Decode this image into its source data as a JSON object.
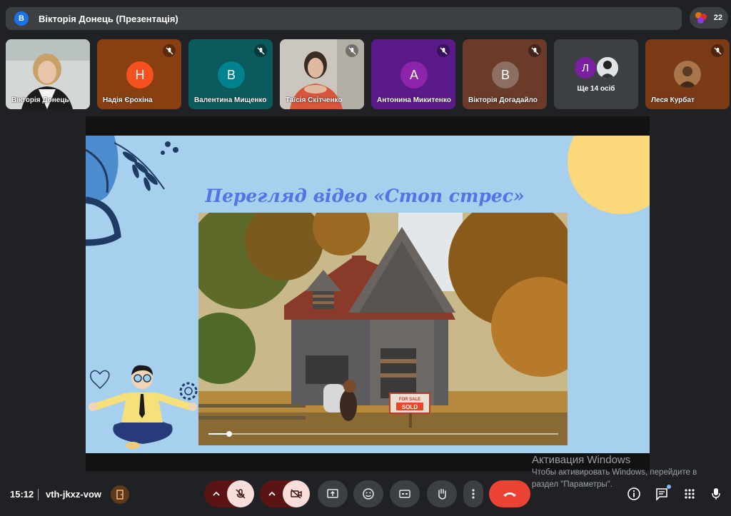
{
  "header": {
    "presenter_initial": "В",
    "presenter_title": "Вікторія Донець (Презентація)",
    "people_count": "22"
  },
  "participants": [
    {
      "name": "Вікторія Донець",
      "type": "video",
      "muted": false
    },
    {
      "name": "Надія Єрохіна",
      "initial": "Н",
      "bg": "#8a3f12",
      "avatar_color": "#f4511e",
      "muted": true
    },
    {
      "name": "Валентина Мищенко",
      "initial": "В",
      "bg": "#0b5a5e",
      "avatar_color": "#00838f",
      "muted": true
    },
    {
      "name": "Таїсія Скітченко",
      "type": "video",
      "muted": true
    },
    {
      "name": "Антонина Микитенко",
      "initial": "А",
      "bg": "#5b1a8a",
      "avatar_color": "#8e24aa",
      "muted": true
    },
    {
      "name": "Вікторія Догадайло",
      "initial": "В",
      "bg": "#6b3a28",
      "avatar_color": "#8d6e63",
      "muted": true
    },
    {
      "name": "Ще 14 осіб",
      "initial": "Л",
      "bg": "#3c4043",
      "avatar_color": "#7b1fa2",
      "muted": false
    },
    {
      "name": "Леся Курбат",
      "bg": "#7a3a16",
      "muted": true
    }
  ],
  "slide": {
    "title": "Перегляд відео «Стоп стрес»",
    "video_progress": 0.06,
    "sign_text_top": "FOR SALE",
    "sign_text": "SOLD"
  },
  "watermark": {
    "line1": "Активация Windows",
    "line2": "Чтобы активировать Windows, перейдите в",
    "line3": "раздел \"Параметры\"."
  },
  "footer": {
    "time": "15:12",
    "meeting_code": "vth-jkxz-vow"
  },
  "colors": {
    "end_call": "#ea4335",
    "muted_ctrl_bg": "#f9dedc",
    "slide_bg": "#a6d0ee",
    "title": "#5473e6"
  }
}
